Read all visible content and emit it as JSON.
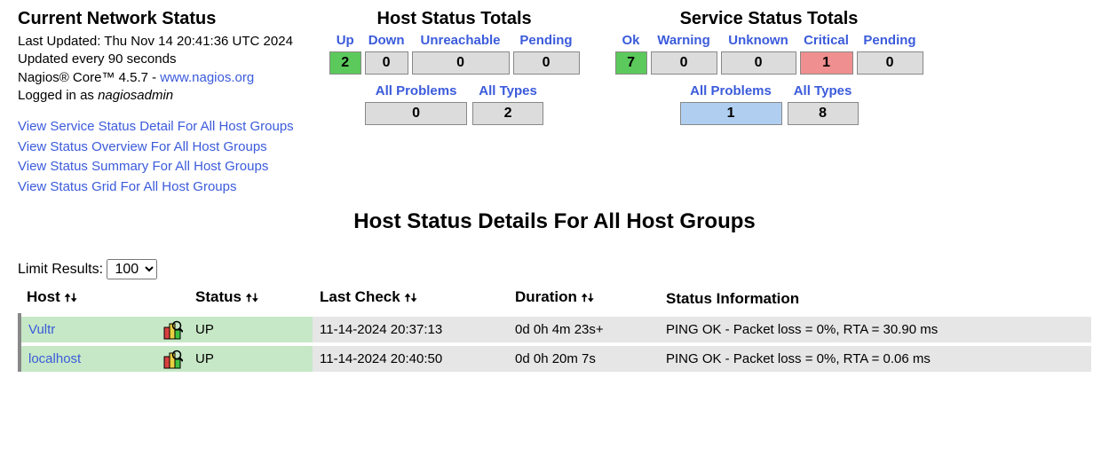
{
  "header": {
    "title": "Current Network Status",
    "last_updated_label": "Last Updated: Thu Nov 14 20:41:36 UTC 2024",
    "update_interval": "Updated every 90 seconds",
    "version_prefix": "Nagios® Core™ 4.5.7 - ",
    "version_link": "www.nagios.org",
    "logged_in_prefix": "Logged in as ",
    "logged_in_user": "nagiosadmin"
  },
  "links": {
    "l1": "View Service Status Detail For All Host Groups",
    "l2": "View Status Overview For All Host Groups",
    "l3": "View Status Summary For All Host Groups",
    "l4": "View Status Grid For All Host Groups"
  },
  "host_totals": {
    "title": "Host Status Totals",
    "up_label": "Up",
    "down_label": "Down",
    "unreachable_label": "Unreachable",
    "pending_label": "Pending",
    "up": "2",
    "down": "0",
    "unreachable": "0",
    "pending": "0",
    "all_problems_label": "All Problems",
    "all_types_label": "All Types",
    "all_problems": "0",
    "all_types": "2"
  },
  "service_totals": {
    "title": "Service Status Totals",
    "ok_label": "Ok",
    "warning_label": "Warning",
    "unknown_label": "Unknown",
    "critical_label": "Critical",
    "pending_label": "Pending",
    "ok": "7",
    "warning": "0",
    "unknown": "0",
    "critical": "1",
    "pending": "0",
    "all_problems_label": "All Problems",
    "all_types_label": "All Types",
    "all_problems": "1",
    "all_types": "8"
  },
  "details": {
    "title": "Host Status Details For All Host Groups",
    "limit_label": "Limit Results: ",
    "limit_value": "100",
    "headers": {
      "host": "Host",
      "status": "Status",
      "last_check": "Last Check",
      "duration": "Duration",
      "status_info": "Status Information"
    },
    "rows": [
      {
        "host": "Vultr",
        "status": "UP",
        "last_check": "11-14-2024 20:37:13",
        "duration": "0d 0h 4m 23s+",
        "info": "PING OK - Packet loss = 0%, RTA = 30.90 ms"
      },
      {
        "host": "localhost",
        "status": "UP",
        "last_check": "11-14-2024 20:40:50",
        "duration": "0d 0h 20m 7s",
        "info": "PING OK - Packet loss = 0%, RTA = 0.06 ms"
      }
    ]
  }
}
